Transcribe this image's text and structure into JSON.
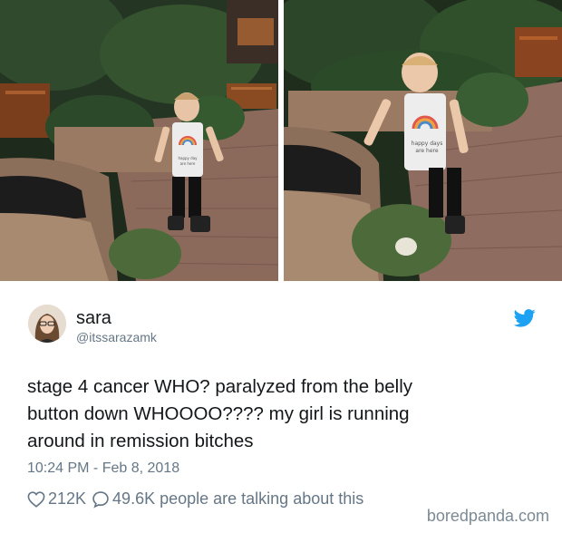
{
  "tweet": {
    "display_name": "sara",
    "handle": "@itssarazamk",
    "text_lines": [
      "stage 4 cancer WHO? paralyzed from the belly",
      "button down WHOOOO???? my girl is running",
      "around in remission bitches"
    ],
    "timestamp": "10:24 PM - Feb 8, 2018",
    "likes": "212K",
    "replies": "49.6K people are talking about this"
  },
  "shirt_text": {
    "left": [
      "happy day",
      "are here"
    ],
    "right": [
      "happy days",
      "are here"
    ]
  },
  "watermark": "boredpanda.com",
  "colors": {
    "twitter_blue": "#1da1f2",
    "meta_gray": "#657786",
    "text": "#14171a"
  },
  "icons": [
    "twitter-bird-icon",
    "heart-icon",
    "reply-bubble-icon"
  ]
}
